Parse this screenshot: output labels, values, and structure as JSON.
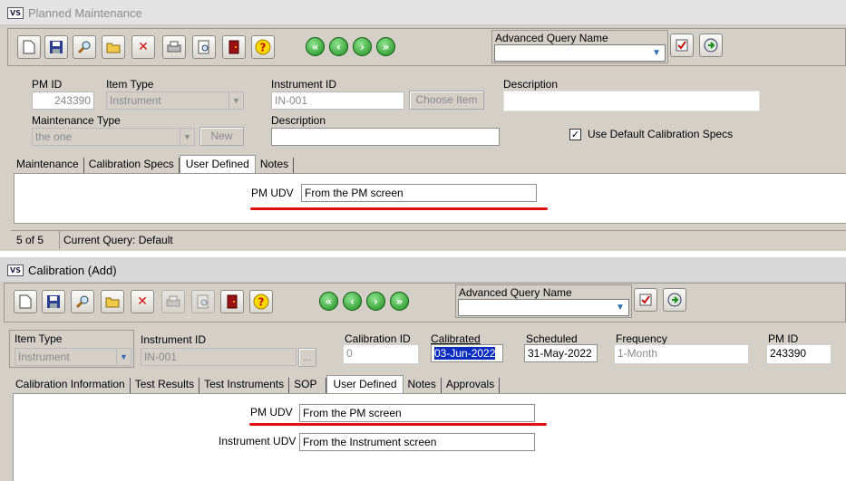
{
  "pm_window": {
    "title": "Planned Maintenance",
    "aq_label": "Advanced Query Name",
    "pm_id_label": "PM ID",
    "pm_id_value": "243390",
    "item_type_label": "Item Type",
    "item_type_value": "Instrument",
    "instrument_id_label": "Instrument ID",
    "instrument_id_value": "IN-001",
    "choose_item_label": "Choose Item",
    "description_label": "Description",
    "description_value": "",
    "maint_type_label": "Maintenance Type",
    "maint_type_value": "the one",
    "new_label": "New",
    "description2_label": "Description",
    "use_default_label": "Use Default Calibration Specs",
    "tabs": [
      "Maintenance",
      "Calibration Specs",
      "User Defined",
      "Notes"
    ],
    "udv_label": "PM UDV",
    "udv_value": "From the PM screen",
    "status_count": "5 of 5",
    "status_query": "Current Query: Default"
  },
  "cal_window": {
    "title": "Calibration (Add)",
    "aq_label": "Advanced Query Name",
    "item_type_label": "Item Type",
    "item_type_value": "Instrument",
    "instrument_id_label": "Instrument ID",
    "instrument_id_value": "IN-001",
    "browse_label": "...",
    "cal_id_label": "Calibration ID",
    "cal_id_value": "0",
    "calibrated_label": "Calibrated",
    "calibrated_value": "03-Jun-2022",
    "scheduled_label": "Scheduled",
    "scheduled_value": "31-May-2022",
    "frequency_label": "Frequency",
    "frequency_value": "1-Month",
    "pm_id_label": "PM ID",
    "pm_id_value": "243390",
    "tabs": [
      "Calibration Information",
      "Test Results",
      "Test Instruments",
      "SOP",
      "User Defined",
      "Notes",
      "Approvals"
    ],
    "pm_udv_label": "PM UDV",
    "pm_udv_value": "From the PM screen",
    "inst_udv_label": "Instrument UDV",
    "inst_udv_value": "From the Instrument screen"
  },
  "app_icon": "VS",
  "icons": {
    "new": "new-document-icon",
    "save": "save-icon",
    "find": "find-icon",
    "open": "open-folder-icon",
    "delete": "delete-icon",
    "print": "print-icon",
    "preview": "print-preview-icon",
    "exit": "exit-icon",
    "help": "help-icon",
    "first": "first-record-icon",
    "prev": "previous-record-icon",
    "next": "next-record-icon",
    "last": "last-record-icon",
    "aq_edit": "edit-query-icon",
    "aq_run": "run-query-icon"
  },
  "colors": {
    "highlight_underline": "#e01010",
    "nav_green": "#1c8c1c",
    "window_face": "#d4d0c8"
  }
}
